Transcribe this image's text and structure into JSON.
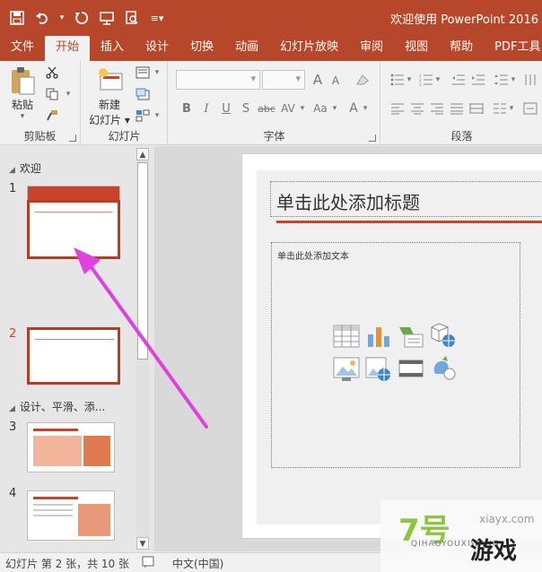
{
  "window": {
    "title": "欢迎使用 PowerPoint 2016"
  },
  "qat": [
    "save-icon",
    "undo-icon",
    "redo-icon",
    "present-icon",
    "preview-icon",
    "customize-icon"
  ],
  "tabs": [
    "文件",
    "开始",
    "插入",
    "设计",
    "切换",
    "动画",
    "幻灯片放映",
    "审阅",
    "视图",
    "帮助",
    "PDF工具"
  ],
  "ribbon": {
    "clipboard": {
      "paste": "粘贴",
      "label": "剪贴板"
    },
    "slides": {
      "new_slide": "新建",
      "new_slide_2": "幻灯片",
      "label": "幻灯片"
    },
    "font": {
      "label": "字体",
      "grow": "A",
      "shrink": "A",
      "bold": "B",
      "italic": "I",
      "underline": "U",
      "shadow": "S",
      "strike": "abc",
      "spacing": "AV",
      "case": "Aa",
      "color": "A"
    },
    "paragraph": {
      "label": "段落"
    }
  },
  "thumbnails": {
    "section1": "欢迎",
    "section2": "设计、平滑、添...",
    "numbers": [
      "1",
      "2",
      "3",
      "4"
    ]
  },
  "slide": {
    "title_placeholder": "单击此处添加标题",
    "content_placeholder": "单击此处添加文本",
    "page_fragment": "7"
  },
  "status": {
    "slide_info": "幻灯片 第 2 张，共 10 张",
    "language": "中文(中国)"
  },
  "watermark": {
    "brand": "7号",
    "url": "xiayx.com",
    "pinyin": "QIHAOYOUXIWANG",
    "game": "游戏"
  },
  "colors": {
    "accent": "#b7472a",
    "selection": "#b83b26",
    "annotation_arrow": "#e040e0"
  }
}
